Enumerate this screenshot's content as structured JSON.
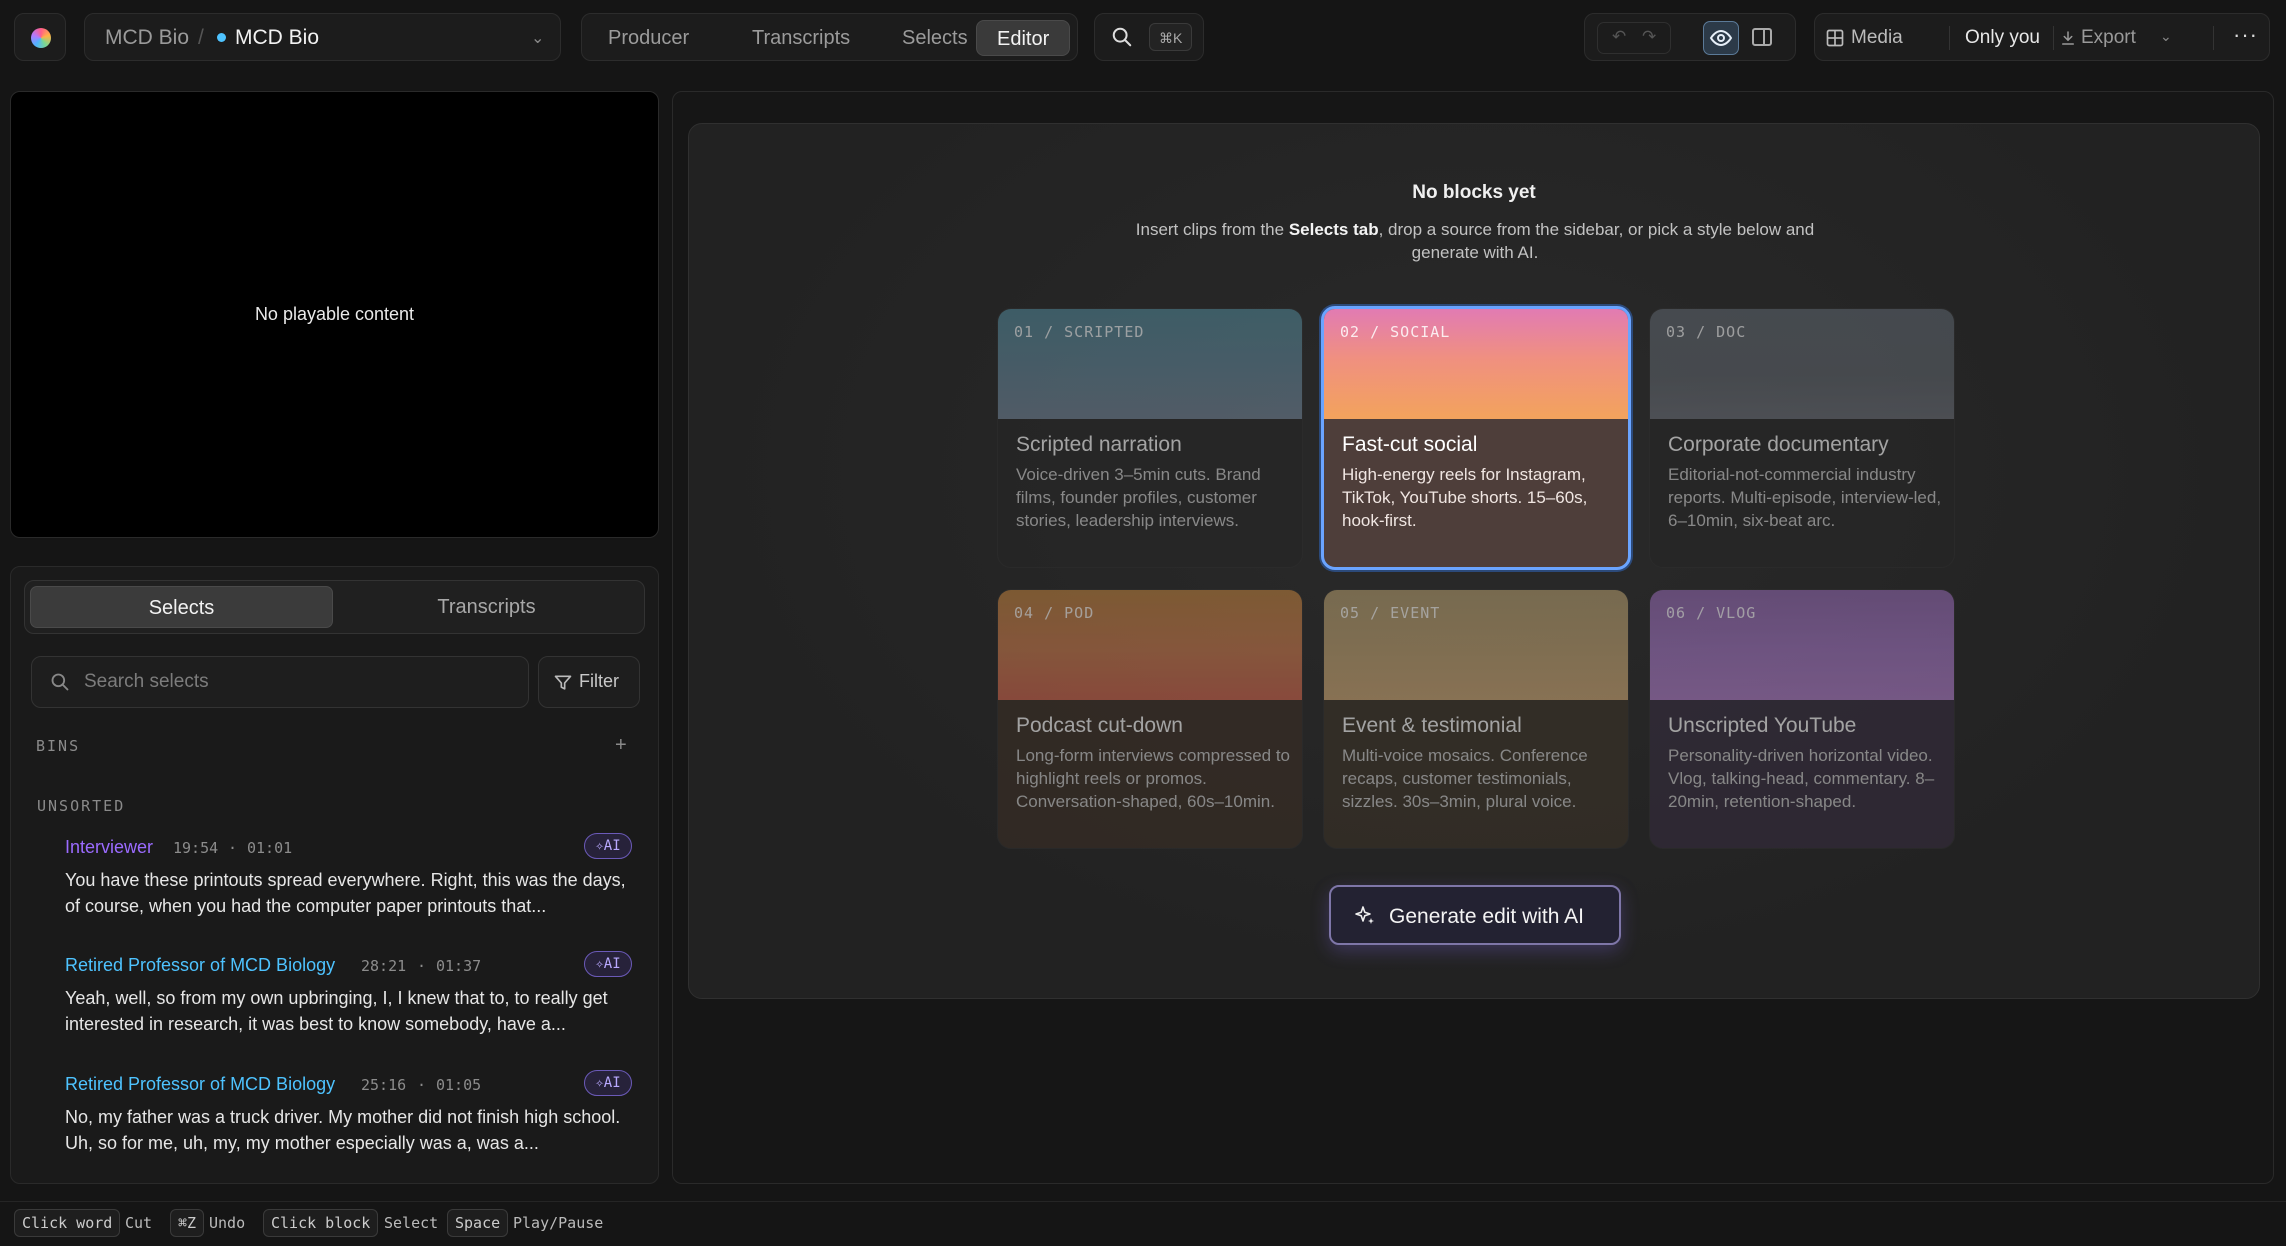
{
  "topbar": {
    "project_parent": "MCD Bio",
    "project_name": "MCD Bio",
    "tabs": [
      "Producer",
      "Transcripts",
      "Selects",
      "Editor"
    ],
    "active_tab": "Editor",
    "search_shortcut": "⌘K",
    "media_label": "Media",
    "share_label": "Only you",
    "export_label": "Export"
  },
  "player": {
    "empty_message": "No playable content"
  },
  "sidebar": {
    "segments": [
      "Selects",
      "Transcripts"
    ],
    "search_placeholder": "Search selects",
    "filter_label": "Filter",
    "bins_label": "BINS",
    "unsorted_label": "UNSORTED",
    "ai_badge": "AI",
    "items": [
      {
        "speaker": "Interviewer",
        "time": "19:54",
        "duration": "01:01",
        "speaker_color": "#9b6bff",
        "text": "You have these printouts spread everywhere. Right, this was the days, of course, when you had the computer paper printouts that..."
      },
      {
        "speaker": "Retired Professor of MCD Biology",
        "time": "28:21",
        "duration": "01:37",
        "speaker_color": "#4ec3ff",
        "text": "Yeah, well, so from my own upbringing, I, I knew that to, to really get interested in research, it was best to know somebody, have a..."
      },
      {
        "speaker": "Retired Professor of MCD Biology",
        "time": "25:16",
        "duration": "01:05",
        "speaker_color": "#4ec3ff",
        "text": "No, my father was a truck driver. My mother did not finish high school. Uh, so for me, uh, my, my mother especially was a, was a..."
      }
    ]
  },
  "editor": {
    "empty_title": "No blocks yet",
    "hint_before": "Insert clips from the ",
    "hint_bold": "Selects tab",
    "hint_after": ", drop a source from the sidebar, or pick a style below and generate with AI.",
    "generate_label": "Generate edit with AI",
    "styles": [
      {
        "tag": "01 / SCRIPTED",
        "title": "Scripted narration",
        "desc": "Voice-driven 3–5min cuts. Brand films, founder profiles, customer stories, leadership interviews.",
        "selected": false
      },
      {
        "tag": "02 / SOCIAL",
        "title": "Fast-cut social",
        "desc": "High-energy reels for Instagram, TikTok, YouTube shorts. 15–60s, hook-first.",
        "selected": true
      },
      {
        "tag": "03 / DOC",
        "title": "Corporate documentary",
        "desc": "Editorial-not-commercial industry reports. Multi-episode, interview-led, 6–10min, six-beat arc.",
        "selected": false
      },
      {
        "tag": "04 / POD",
        "title": "Podcast cut-down",
        "desc": "Long-form interviews compressed to highlight reels or promos. Conversation-shaped, 60s–10min.",
        "selected": false
      },
      {
        "tag": "05 / EVENT",
        "title": "Event & testimonial",
        "desc": "Multi-voice mosaics. Conference recaps, customer testimonials, sizzles. 30s–3min, plural voice.",
        "selected": false
      },
      {
        "tag": "06 / VLOG",
        "title": "Unscripted YouTube",
        "desc": "Personality-driven horizontal video. Vlog, talking-head, commentary. 8–20min, retention-shaped.",
        "selected": false
      }
    ]
  },
  "statusbar": {
    "shortcuts": [
      {
        "key": "Click word",
        "action": "Cut"
      },
      {
        "key": "⌘Z",
        "action": "Undo"
      },
      {
        "key": "Click block",
        "action": "Select"
      },
      {
        "key": "Space",
        "action": "Play/Pause"
      }
    ]
  },
  "colors": {
    "accent": "#6aa4ff",
    "ai_purple": "#9b6bff",
    "speaker_blue": "#4ec3ff"
  }
}
